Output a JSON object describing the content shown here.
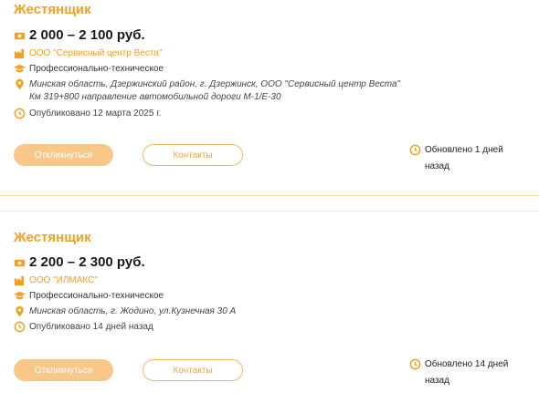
{
  "colors": {
    "accent": "#f2a024",
    "button_primary": "#f8c888",
    "button_outline": "#f0b96a"
  },
  "vacancies": [
    {
      "title": "Жестянщик",
      "salary": "2 000 – 2 100 руб.",
      "company": "ООО \"Сервисный центр Веста\"",
      "education": "Профессионально-техническое",
      "address": "Минская область, Дзержинский район, г. Дзержинск, ООО \"Сервисный центр Веста\" Км 319+800 направление автомобильной дороги М-1/Е-30",
      "published": "Опубликовано 12 марта 2025 г.",
      "apply_label": "Откликнуться",
      "contacts_label": "Контакты",
      "updated": "Обновлено 1 дней назад",
      "icons": {
        "salary": "money-icon",
        "company": "factory-icon",
        "education": "graduation-cap-icon",
        "address": "location-pin-icon",
        "published": "clock-icon",
        "updated": "clock-icon"
      }
    },
    {
      "title": "Жестянщик",
      "salary": "2 200 – 2 300 руб.",
      "company": "ООО \"ИЛМАКС\"",
      "education": "Профессионально-техническое",
      "address": "Минская область, г. Жодино, ул.Кузнечная 30 А",
      "published": "Опубликовано 14 дней назад",
      "apply_label": "Откликнуться",
      "contacts_label": "Контакты",
      "updated": "Обновлено 14 дней назад",
      "icons": {
        "salary": "money-icon",
        "company": "factory-icon",
        "education": "graduation-cap-icon",
        "address": "location-pin-icon",
        "published": "clock-icon",
        "updated": "clock-icon"
      }
    }
  ]
}
